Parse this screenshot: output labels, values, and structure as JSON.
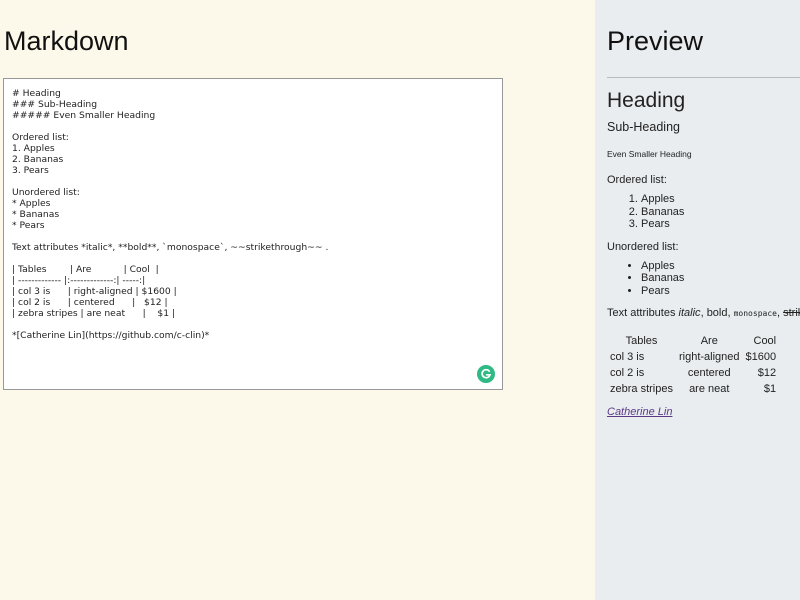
{
  "markdown": {
    "title": "Markdown",
    "source": "# Heading\n### Sub-Heading\n##### Even Smaller Heading\n\nOrdered list:\n1. Apples\n2. Bananas\n3. Pears\n\nUnordered list:\n* Apples\n* Bananas\n* Pears\n\nText attributes *italic*, **bold**, `monospace`, ~~strikethrough~~ .\n\n| Tables        | Are           | Cool  |\n| ------------- |:-------------:| -----:|\n| col 3 is      | right-aligned | $1600 |\n| col 2 is      | centered      |   $12 |\n| zebra stripes | are neat      |    $1 |\n\n*[Catherine Lin](https://github.com/c-clin)*"
  },
  "preview": {
    "title": "Preview",
    "h1": "Heading",
    "h3": "Sub-Heading",
    "h5": "Even Smaller Heading",
    "ordered_label": "Ordered list:",
    "ordered_items": [
      "Apples",
      "Bananas",
      "Pears"
    ],
    "unordered_label": "Unordered list:",
    "unordered_items": [
      "Apples",
      "Bananas",
      "Pears"
    ],
    "text_attr": {
      "prefix": "Text attributes ",
      "italic": "italic",
      "bold": "bold",
      "mono": "monospace",
      "strike": "strikethrough",
      "sep": ", "
    },
    "table": {
      "headers": [
        "Tables",
        "Are",
        "Cool"
      ],
      "rows": [
        [
          "col 3 is",
          "right-aligned",
          "$1600"
        ],
        [
          "col 2 is",
          "centered",
          "$12"
        ],
        [
          "zebra stripes",
          "are neat",
          "$1"
        ]
      ]
    },
    "link_text": "Catherine Lin"
  },
  "colors": {
    "left_bg": "#fdf9ea",
    "right_bg": "#e9edf0",
    "badge": "#2fb984",
    "link": "#5d3a86"
  },
  "icons": {
    "grammarly": "grammarly-icon"
  }
}
